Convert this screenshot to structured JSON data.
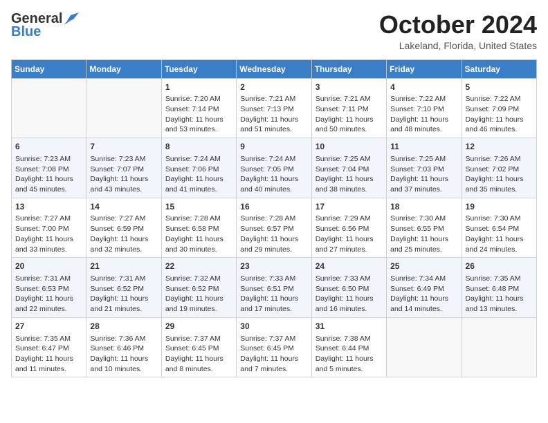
{
  "header": {
    "logo_general": "General",
    "logo_blue": "Blue",
    "month": "October 2024",
    "location": "Lakeland, Florida, United States"
  },
  "days_of_week": [
    "Sunday",
    "Monday",
    "Tuesday",
    "Wednesday",
    "Thursday",
    "Friday",
    "Saturday"
  ],
  "weeks": [
    [
      {
        "day": "",
        "sunrise": "",
        "sunset": "",
        "daylight": ""
      },
      {
        "day": "",
        "sunrise": "",
        "sunset": "",
        "daylight": ""
      },
      {
        "day": "1",
        "sunrise": "Sunrise: 7:20 AM",
        "sunset": "Sunset: 7:14 PM",
        "daylight": "Daylight: 11 hours and 53 minutes."
      },
      {
        "day": "2",
        "sunrise": "Sunrise: 7:21 AM",
        "sunset": "Sunset: 7:13 PM",
        "daylight": "Daylight: 11 hours and 51 minutes."
      },
      {
        "day": "3",
        "sunrise": "Sunrise: 7:21 AM",
        "sunset": "Sunset: 7:11 PM",
        "daylight": "Daylight: 11 hours and 50 minutes."
      },
      {
        "day": "4",
        "sunrise": "Sunrise: 7:22 AM",
        "sunset": "Sunset: 7:10 PM",
        "daylight": "Daylight: 11 hours and 48 minutes."
      },
      {
        "day": "5",
        "sunrise": "Sunrise: 7:22 AM",
        "sunset": "Sunset: 7:09 PM",
        "daylight": "Daylight: 11 hours and 46 minutes."
      }
    ],
    [
      {
        "day": "6",
        "sunrise": "Sunrise: 7:23 AM",
        "sunset": "Sunset: 7:08 PM",
        "daylight": "Daylight: 11 hours and 45 minutes."
      },
      {
        "day": "7",
        "sunrise": "Sunrise: 7:23 AM",
        "sunset": "Sunset: 7:07 PM",
        "daylight": "Daylight: 11 hours and 43 minutes."
      },
      {
        "day": "8",
        "sunrise": "Sunrise: 7:24 AM",
        "sunset": "Sunset: 7:06 PM",
        "daylight": "Daylight: 11 hours and 41 minutes."
      },
      {
        "day": "9",
        "sunrise": "Sunrise: 7:24 AM",
        "sunset": "Sunset: 7:05 PM",
        "daylight": "Daylight: 11 hours and 40 minutes."
      },
      {
        "day": "10",
        "sunrise": "Sunrise: 7:25 AM",
        "sunset": "Sunset: 7:04 PM",
        "daylight": "Daylight: 11 hours and 38 minutes."
      },
      {
        "day": "11",
        "sunrise": "Sunrise: 7:25 AM",
        "sunset": "Sunset: 7:03 PM",
        "daylight": "Daylight: 11 hours and 37 minutes."
      },
      {
        "day": "12",
        "sunrise": "Sunrise: 7:26 AM",
        "sunset": "Sunset: 7:02 PM",
        "daylight": "Daylight: 11 hours and 35 minutes."
      }
    ],
    [
      {
        "day": "13",
        "sunrise": "Sunrise: 7:27 AM",
        "sunset": "Sunset: 7:00 PM",
        "daylight": "Daylight: 11 hours and 33 minutes."
      },
      {
        "day": "14",
        "sunrise": "Sunrise: 7:27 AM",
        "sunset": "Sunset: 6:59 PM",
        "daylight": "Daylight: 11 hours and 32 minutes."
      },
      {
        "day": "15",
        "sunrise": "Sunrise: 7:28 AM",
        "sunset": "Sunset: 6:58 PM",
        "daylight": "Daylight: 11 hours and 30 minutes."
      },
      {
        "day": "16",
        "sunrise": "Sunrise: 7:28 AM",
        "sunset": "Sunset: 6:57 PM",
        "daylight": "Daylight: 11 hours and 29 minutes."
      },
      {
        "day": "17",
        "sunrise": "Sunrise: 7:29 AM",
        "sunset": "Sunset: 6:56 PM",
        "daylight": "Daylight: 11 hours and 27 minutes."
      },
      {
        "day": "18",
        "sunrise": "Sunrise: 7:30 AM",
        "sunset": "Sunset: 6:55 PM",
        "daylight": "Daylight: 11 hours and 25 minutes."
      },
      {
        "day": "19",
        "sunrise": "Sunrise: 7:30 AM",
        "sunset": "Sunset: 6:54 PM",
        "daylight": "Daylight: 11 hours and 24 minutes."
      }
    ],
    [
      {
        "day": "20",
        "sunrise": "Sunrise: 7:31 AM",
        "sunset": "Sunset: 6:53 PM",
        "daylight": "Daylight: 11 hours and 22 minutes."
      },
      {
        "day": "21",
        "sunrise": "Sunrise: 7:31 AM",
        "sunset": "Sunset: 6:52 PM",
        "daylight": "Daylight: 11 hours and 21 minutes."
      },
      {
        "day": "22",
        "sunrise": "Sunrise: 7:32 AM",
        "sunset": "Sunset: 6:52 PM",
        "daylight": "Daylight: 11 hours and 19 minutes."
      },
      {
        "day": "23",
        "sunrise": "Sunrise: 7:33 AM",
        "sunset": "Sunset: 6:51 PM",
        "daylight": "Daylight: 11 hours and 17 minutes."
      },
      {
        "day": "24",
        "sunrise": "Sunrise: 7:33 AM",
        "sunset": "Sunset: 6:50 PM",
        "daylight": "Daylight: 11 hours and 16 minutes."
      },
      {
        "day": "25",
        "sunrise": "Sunrise: 7:34 AM",
        "sunset": "Sunset: 6:49 PM",
        "daylight": "Daylight: 11 hours and 14 minutes."
      },
      {
        "day": "26",
        "sunrise": "Sunrise: 7:35 AM",
        "sunset": "Sunset: 6:48 PM",
        "daylight": "Daylight: 11 hours and 13 minutes."
      }
    ],
    [
      {
        "day": "27",
        "sunrise": "Sunrise: 7:35 AM",
        "sunset": "Sunset: 6:47 PM",
        "daylight": "Daylight: 11 hours and 11 minutes."
      },
      {
        "day": "28",
        "sunrise": "Sunrise: 7:36 AM",
        "sunset": "Sunset: 6:46 PM",
        "daylight": "Daylight: 11 hours and 10 minutes."
      },
      {
        "day": "29",
        "sunrise": "Sunrise: 7:37 AM",
        "sunset": "Sunset: 6:45 PM",
        "daylight": "Daylight: 11 hours and 8 minutes."
      },
      {
        "day": "30",
        "sunrise": "Sunrise: 7:37 AM",
        "sunset": "Sunset: 6:45 PM",
        "daylight": "Daylight: 11 hours and 7 minutes."
      },
      {
        "day": "31",
        "sunrise": "Sunrise: 7:38 AM",
        "sunset": "Sunset: 6:44 PM",
        "daylight": "Daylight: 11 hours and 5 minutes."
      },
      {
        "day": "",
        "sunrise": "",
        "sunset": "",
        "daylight": ""
      },
      {
        "day": "",
        "sunrise": "",
        "sunset": "",
        "daylight": ""
      }
    ]
  ]
}
